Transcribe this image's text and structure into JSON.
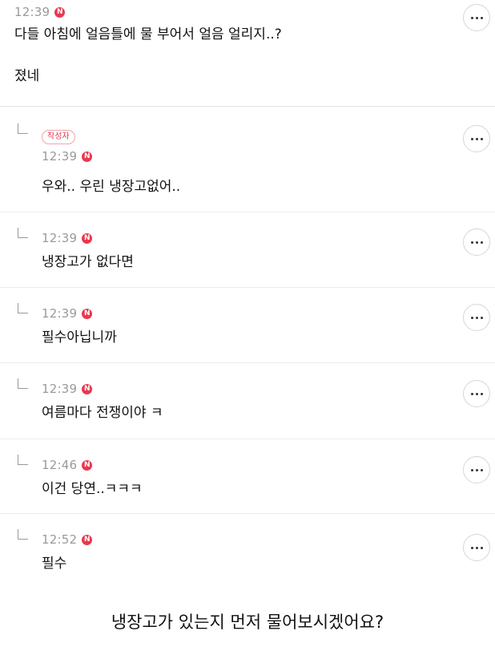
{
  "comments": [
    {
      "time": "12:39",
      "badge": "N",
      "text": "다들 아침에 얼음틀에 물 부어서 얼음 얼리지..?\n\n졌네",
      "reply": false
    },
    {
      "time": "12:39",
      "badge": "N",
      "author_badge": "작성자",
      "text": "우와.. 우린 냉장고없어..",
      "reply": true
    },
    {
      "time": "12:39",
      "badge": "N",
      "text": "냉장고가 없다면",
      "reply": true
    },
    {
      "time": "12:39",
      "badge": "N",
      "text": "필수아닙니까",
      "reply": true
    },
    {
      "time": "12:39",
      "badge": "N",
      "text": "여름마다 전쟁이야 ㅋ",
      "reply": true
    },
    {
      "time": "12:46",
      "badge": "N",
      "text": "이건 당연..ㅋㅋㅋ",
      "reply": true
    },
    {
      "time": "12:52",
      "badge": "N",
      "text": "필수",
      "reply": true
    }
  ],
  "icons": {
    "reply": "reply-arrow-icon",
    "more": "more-options-icon"
  },
  "colors": {
    "badge": "#e8384f",
    "timestamp": "#9a9a9a",
    "divider": "#ececec"
  },
  "caption": "냉장고가 있는지 먼저 물어보시겠어요?"
}
